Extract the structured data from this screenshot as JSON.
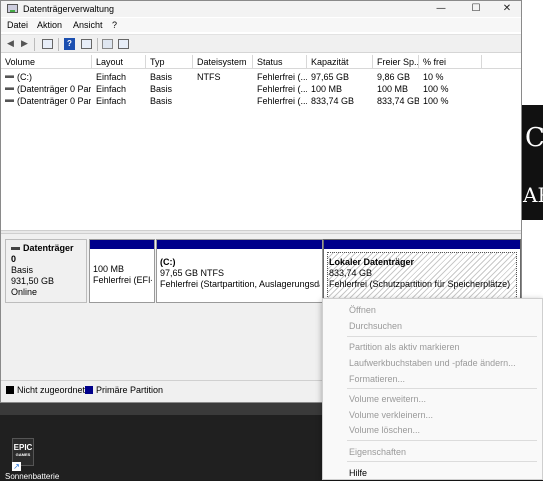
{
  "window": {
    "title": "Datenträgerverwaltung",
    "controls": {
      "minimize": "—",
      "maximize": "☐",
      "close": "✕"
    }
  },
  "menubar": [
    "Datei",
    "Aktion",
    "Ansicht",
    "?"
  ],
  "toolbar": {
    "back": "◀",
    "forward": "▶",
    "help": "?"
  },
  "volume_list": {
    "columns": [
      "Volume",
      "Layout",
      "Typ",
      "Dateisystem",
      "Status",
      "Kapazität",
      "Freier Sp...",
      "% frei"
    ],
    "rows": [
      [
        "(C:)",
        "Einfach",
        "Basis",
        "NTFS",
        "Fehlerfrei (...",
        "97,65 GB",
        "9,86 GB",
        "10 %"
      ],
      [
        "(Datenträger 0 Par...",
        "Einfach",
        "Basis",
        "",
        "Fehlerfrei (...",
        "100 MB",
        "100 MB",
        "100 %"
      ],
      [
        "(Datenträger 0 Par...",
        "Einfach",
        "Basis",
        "",
        "Fehlerfrei (...",
        "833,74 GB",
        "833,74 GB",
        "100 %"
      ]
    ]
  },
  "disk": {
    "name": "Datenträger 0",
    "type": "Basis",
    "size": "931,50 GB",
    "state": "Online",
    "partitions": [
      {
        "title": "",
        "size": "100 MB",
        "status": "Fehlerfrei (EFI-Systempartition)"
      },
      {
        "title": "(C:)",
        "size": "97,65 GB NTFS",
        "status": "Fehlerfrei (Startpartition, Auslagerungsdatei)"
      },
      {
        "title": "Lokaler Datenträger",
        "size": "833,74 GB",
        "status": "Fehlerfrei (Schutzpartition für Speicherplätze)"
      }
    ]
  },
  "legend": {
    "items": [
      {
        "label": "Nicht zugeordnet",
        "color": "#000000"
      },
      {
        "label": "Primäre Partition",
        "color": "#00008b"
      }
    ]
  },
  "context_menu": {
    "items": [
      {
        "label": "Öffnen",
        "enabled": false
      },
      {
        "label": "Durchsuchen",
        "enabled": false
      },
      {
        "label": "Partition als aktiv markieren",
        "enabled": false
      },
      {
        "label": "Laufwerkbuchstaben und -pfade ändern...",
        "enabled": false
      },
      {
        "label": "Formatieren...",
        "enabled": false
      },
      {
        "label": "Volume erweitern...",
        "enabled": false
      },
      {
        "label": "Volume verkleinern...",
        "enabled": false
      },
      {
        "label": "Volume löschen...",
        "enabled": false
      },
      {
        "label": "Eigenschaften",
        "enabled": false
      },
      {
        "label": "Hilfe",
        "enabled": true
      }
    ]
  },
  "desktop": {
    "background_glyphs": [
      "C",
      "AP"
    ],
    "epic_icon": {
      "line1": "EPIC",
      "line2": "GAMES"
    },
    "shortcut_arrow": "↗",
    "label": "Sonnenbatterie"
  },
  "colors": {
    "primary_partition": "#00008b",
    "unallocated": "#000000",
    "disabled_text": "#9a9a9a"
  }
}
